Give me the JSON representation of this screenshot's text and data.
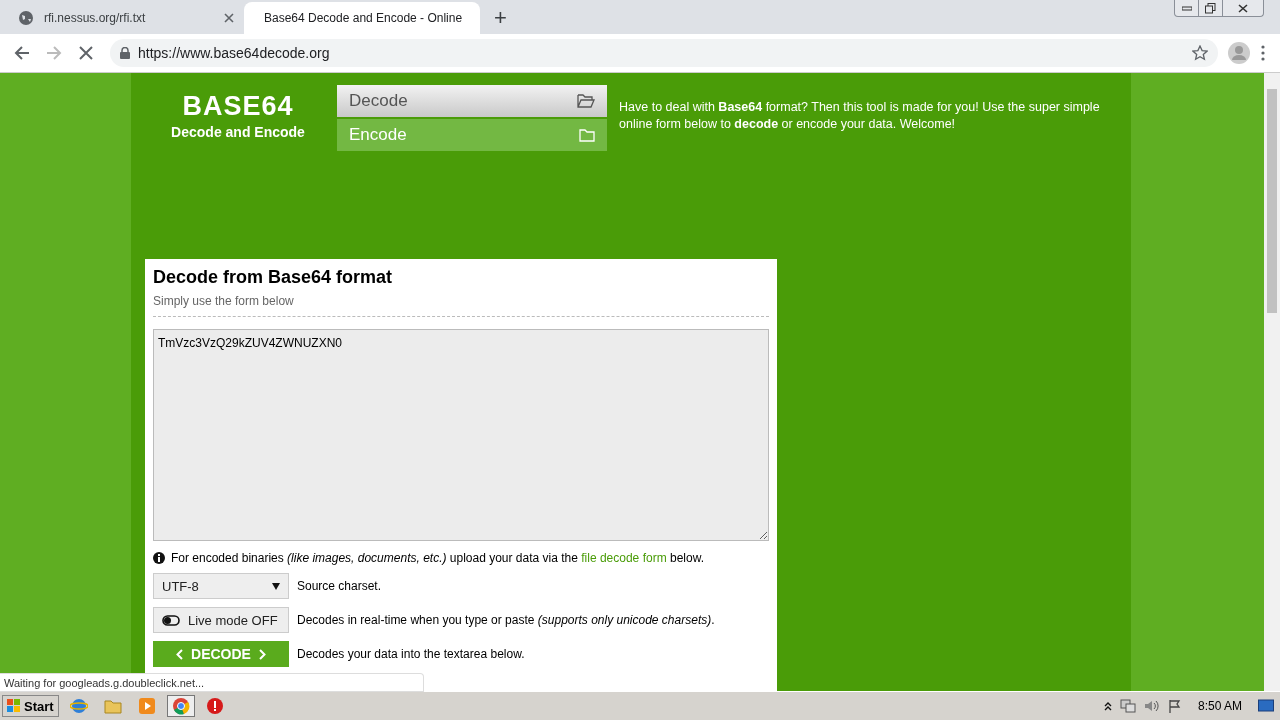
{
  "browser": {
    "tabs": [
      {
        "title": "rfi.nessus.org/rfi.txt",
        "selected": false,
        "loading": false
      },
      {
        "title": "Base64 Decode and Encode - Online",
        "selected": true,
        "loading": true
      }
    ],
    "new_tab": "+",
    "url": "https://www.base64decode.org"
  },
  "site": {
    "logo": {
      "title": "BASE64",
      "subtitle": "Decode and Encode"
    },
    "menu": [
      {
        "label": "Decode",
        "selected": true
      },
      {
        "label": "Encode",
        "selected": false
      }
    ],
    "intro": "Have to deal with **Base64** format? Then this tool is made for you! Use the super simple online form below to **decode** or encode your data. Welcome!",
    "card": {
      "title": "Decode from Base64 format",
      "subtitle": "Simply use the form below",
      "input": "TmVzc3VzQ29kZUV4ZWNUZXN0",
      "info": {
        "before": "For encoded binaries *(like images, documents, etc.)* upload your data via the ",
        "link": "file decode form",
        "after": " below."
      },
      "charset": {
        "value": "UTF-8",
        "caption": "Source charset."
      },
      "live_mode": {
        "label": "Live mode OFF",
        "on": false,
        "caption": "Decodes in real-time when you type or paste *(supports only unicode charsets)*."
      },
      "decode": {
        "label": "DECODE",
        "caption": "Decodes your data into the textarea below."
      }
    }
  },
  "status_bubble": "Waiting for googleads.g.doubleclick.net...",
  "taskbar": {
    "start": "Start",
    "apps": [
      {
        "kind": "ie",
        "selected": false
      },
      {
        "kind": "folder",
        "selected": false
      },
      {
        "kind": "media",
        "selected": false
      },
      {
        "kind": "chrome",
        "selected": true
      },
      {
        "kind": "stop",
        "selected": false
      }
    ],
    "time": "8:50 AM"
  }
}
